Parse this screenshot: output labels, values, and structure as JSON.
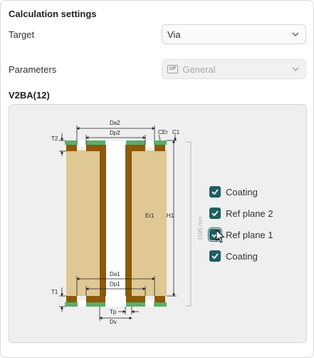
{
  "panel": {
    "title": "Calculation settings"
  },
  "target": {
    "label": "Target",
    "value": "Via"
  },
  "parameters": {
    "label": "Parameters",
    "badge": "UF",
    "value": "General"
  },
  "section": {
    "title": "V2BA(12)"
  },
  "diagram": {
    "labels": {
      "da2": "Da2",
      "dp2": "Dp2",
      "cer": "CEr",
      "c1": "C1",
      "t2": "T2",
      "er1": "Er1",
      "h1": "H1",
      "da1": "Da1",
      "dp1": "Dp1",
      "t1": "T1",
      "tp": "Tp",
      "dv": "Dv"
    },
    "dimension": "1595 mm",
    "colors": {
      "dielectric": "#dfc894",
      "copper": "#8a5a0a",
      "plane": "#5aae6b"
    }
  },
  "checkboxes": [
    {
      "label": "Coating",
      "checked": true
    },
    {
      "label": "Ref plane 2",
      "checked": true
    },
    {
      "label": "Ref plane 1",
      "checked": true
    },
    {
      "label": "Coating",
      "checked": true
    }
  ],
  "accent": "#1f5e60"
}
